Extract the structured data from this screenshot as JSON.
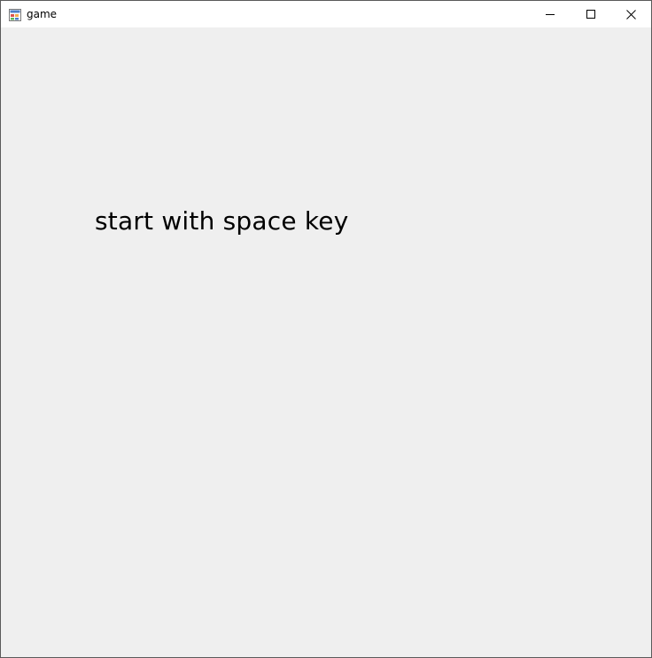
{
  "window": {
    "title": "game"
  },
  "icons": {
    "app": "app-form-icon",
    "minimize": "minimize-icon",
    "maximize": "maximize-icon",
    "close": "close-icon"
  },
  "game": {
    "prompt": "start with space key"
  },
  "colors": {
    "titlebar": "#ffffff",
    "client_background": "#efefef",
    "border": "#5a5a5a",
    "text": "#000000"
  }
}
